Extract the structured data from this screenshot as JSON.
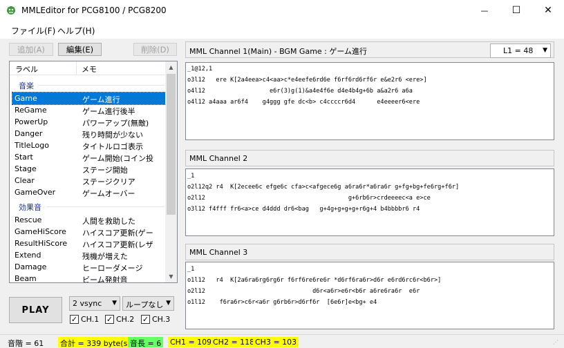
{
  "window": {
    "title": "MMLEditor for PCG8100 / PCG8200",
    "minimize": "—",
    "maximize": "☐",
    "close": "✕"
  },
  "menu": {
    "file": "ファイル(F)",
    "help": "ヘルプ(H)"
  },
  "toolbar": {
    "add": "追加(A)",
    "edit": "編集(E)",
    "delete": "削除(D)"
  },
  "list": {
    "header_label": "ラベル",
    "header_memo": "メモ",
    "groups": [
      {
        "name": "音楽",
        "items": [
          {
            "label": "Game",
            "memo": "ゲーム進行",
            "selected": true
          },
          {
            "label": "ReGame",
            "memo": "ゲーム進行後半"
          },
          {
            "label": "PowerUp",
            "memo": "パワーアップ(無敵)"
          },
          {
            "label": "Danger",
            "memo": "残り時間が少ない"
          },
          {
            "label": "TitleLogo",
            "memo": "タイトルロゴ表示"
          },
          {
            "label": "Start",
            "memo": "ゲーム開始(コイン投"
          },
          {
            "label": "Stage",
            "memo": "ステージ開始"
          },
          {
            "label": "Clear",
            "memo": "ステージクリア"
          },
          {
            "label": "GameOver",
            "memo": "ゲームオーバー"
          }
        ]
      },
      {
        "name": "効果音",
        "items": [
          {
            "label": "Rescue",
            "memo": "人間を救助した"
          },
          {
            "label": "GameHiScore",
            "memo": "ハイスコア更新(ゲー"
          },
          {
            "label": "ResultHiScore",
            "memo": "ハイスコア更新(レザ"
          },
          {
            "label": "Extend",
            "memo": "残機が増えた"
          },
          {
            "label": "Damage",
            "memo": "ヒーローダメージ"
          },
          {
            "label": "Beam",
            "memo": "ビーム発射音"
          }
        ]
      }
    ]
  },
  "controls": {
    "play": "PLAY",
    "vsync": "2 vsync",
    "loop": "ループなし",
    "ch1": "CH.1",
    "ch2": "CH.2",
    "ch3": "CH.3"
  },
  "channels": [
    {
      "header": "MML Channel 1(Main) - BGM Game : ゲーム進行",
      "length_select": "L1 = 48",
      "lines": [
        "_1@12,1",
        "o3l12   ere K[2a4eea>c4<aa>c*e4eefe6rd6e f6rf6rd6rf6r e&e2r6 <ere>]",
        "o4l12                  e6r(3)g(1)&a4e4f6e d4e4b4g+6b a&a2r6 a6a",
        "o4l12 a4aaa ar6f4    g4ggg gfe dc<b> c4ccccr6d4      e4eeeer6<ere"
      ]
    },
    {
      "header": "MML Channel 2",
      "lines": [
        "_1",
        "o2l12q2 r4  K[2ecee6c efge6c cfa>c<afgece6g a6ra6r*a6ra6r g+fg+bg+fe6rg+f6r]",
        "o2l12                                        g+6rb6r>crdeeeec<a e>ce",
        "o3l12 f4fff fr6<a>ce d4ddd dr6<bag   g+4g+g+g+g+r6g+4 b4bbbbr6 r4"
      ]
    },
    {
      "header": "MML Channel 3",
      "lines": [
        "_1",
        "o1l12   r4  K[2a6ra6rg6rg6r f6rf6re6re6r *d6rf6ra6r>d6r e6rd6rc6r<b6r>]",
        "o2l12                              d6r<a6r>e6r<b6r a6re6ra6r  e6r",
        "o1l12    f6ra6r>c6r<a6r g6rb6r>d6rf6r  [6e6r]e<bg+ e4"
      ]
    }
  ],
  "status": {
    "pitch": "音階 = 61",
    "total": "合計 = 339 byte(s)",
    "length": "音長 = 6",
    "ch1": "CH1 = 109",
    "ch2": "CH2 = 118",
    "ch3": "CH3 = 103"
  },
  "colors": {
    "selection": "#0078d7",
    "status_yellow": "#ffff00",
    "status_green": "#66ff66",
    "group_header": "#1e3287"
  }
}
